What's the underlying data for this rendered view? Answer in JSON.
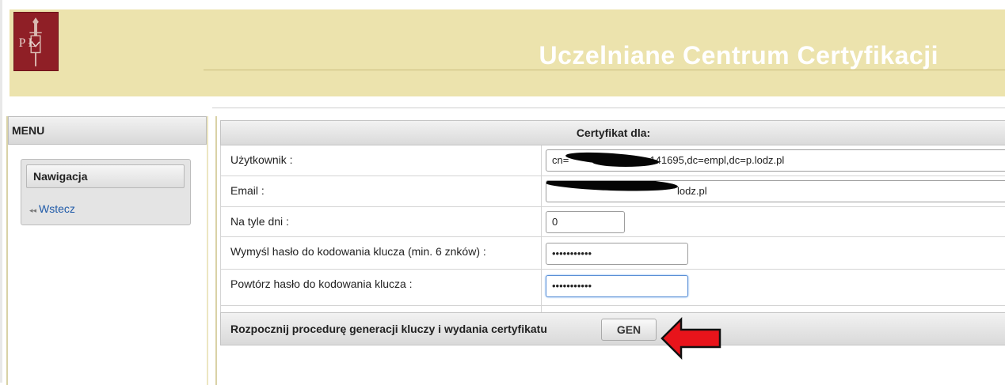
{
  "header": {
    "logo_text": "P Ł",
    "title": "Uczelniane Centrum Certyfikacji"
  },
  "menu": {
    "title": "MENU",
    "nav": {
      "title": "Nawigacja",
      "back_icon": "double-left-arrow-icon",
      "back_label": "Wstecz"
    }
  },
  "form": {
    "title": "Certyfikat dla:",
    "fields": [
      {
        "label": "Użytkownik :",
        "value": "cn=",
        "value_tail": "z 141695,dc=empl,dc=p.lodz.pl"
      },
      {
        "label": "Email :",
        "value_tail": "lodz.pl"
      },
      {
        "label": "Na tyle dni :",
        "value": "0"
      },
      {
        "label": "Wymyśl hasło do kodowania klucza (min. 6 znków) :",
        "value": "•••••••••••"
      },
      {
        "label": "Powtórz hasło do kodowania klucza :",
        "value": "•••••••••••"
      }
    ],
    "submit_label": "Rozpocznij procedurę generacji kluczy i wydania certyfikatu",
    "gen_button": "GEN"
  },
  "colors": {
    "header_bg": "#ece3ad",
    "logo_red": "#8f1f26",
    "link_blue": "#1f5aa8",
    "arrow_red": "#e8141b"
  }
}
